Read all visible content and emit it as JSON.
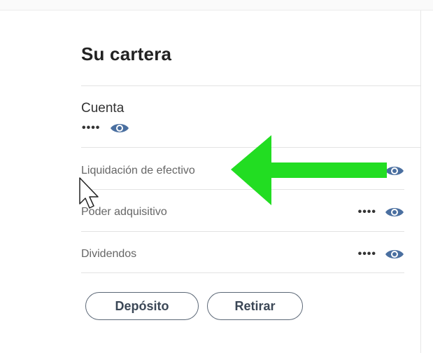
{
  "portfolio": {
    "title": "Su cartera",
    "account": {
      "label": "Cuenta",
      "value": "••••"
    },
    "rows": [
      {
        "label": "Liquidación de efectivo",
        "value": "••••"
      },
      {
        "label": "Poder adquisitivo",
        "value": "••••"
      },
      {
        "label": "Dividendos",
        "value": "••••"
      }
    ],
    "buttons": {
      "deposit": "Depósito",
      "withdraw": "Retirar"
    }
  },
  "icons": {
    "visibility": "eye-icon",
    "pointer": "mouse-cursor-icon",
    "annotation": "green-arrow-icon"
  },
  "colors": {
    "eye": "#4a6fa0",
    "arrow": "#22dd22",
    "button_border": "#5b6776"
  }
}
